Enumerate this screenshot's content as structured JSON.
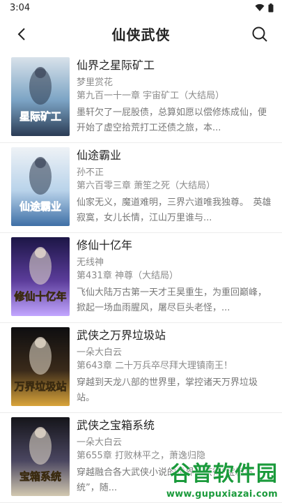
{
  "status_bar": {
    "time": "3:04"
  },
  "header": {
    "title": "仙侠武侠"
  },
  "books": [
    {
      "title": "仙界之星际矿工",
      "author": "梦里赏花",
      "chapter": "第九百一十一章 宇宙矿工（大结局）",
      "description": "墨轩欠了一屁股债，总算如愿以偿修炼成仙，便开始了虚空拾荒打工还债之旅，本...",
      "cover_text": "星际矿工",
      "cover_colors": [
        "#d8e2ea",
        "#7ba3c4",
        "#2b3c55"
      ]
    },
    {
      "title": "仙途霸业",
      "author": "孙不正",
      "chapter": "第六百零三章 萧笙之死（大结局）",
      "description": "仙家无义，魔道难明，三界六道唯我独尊。　英雄寂寞，女儿长情，江山万里谁与...",
      "cover_text": "仙途霸业",
      "cover_colors": [
        "#eef2f6",
        "#b9d3ea",
        "#3e6fa6"
      ]
    },
    {
      "title": "修仙十亿年",
      "author": "无线神",
      "chapter": "第431章 神尊（大结局）",
      "description": "飞仙大陆万古第一天才王昊重生，为重回巅峰，掀起一场血雨腥风，屠尽巨头老怪，...",
      "cover_text": "修仙十亿年",
      "cover_colors": [
        "#1c1646",
        "#5b3c9a",
        "#c2a6ff"
      ]
    },
    {
      "title": "武侠之万界垃圾站",
      "author": "一朵大白云",
      "chapter": "第643章 二十万兵卒尽拜大理镇南王！",
      "description": "穿越到天龙八部的世界里，掌控诸天万界垃圾站。",
      "cover_text": "万界垃圾站",
      "cover_colors": [
        "#0e0e10",
        "#3a2a1a",
        "#d9a43a"
      ]
    },
    {
      "title": "武侠之宝箱系统",
      "author": "一朵大白云",
      "chapter": "第655章 打败林平之，萧逸归隐",
      "description": "穿越融合各大武侠小说的世界，获得“宝箱系统”，随...",
      "cover_text": "宝箱系统",
      "cover_colors": [
        "#15151a",
        "#4a4660",
        "#d2c8b0"
      ]
    }
  ],
  "watermark": {
    "text": "谷普软件园",
    "url": "www.gupuxiazai.com"
  }
}
